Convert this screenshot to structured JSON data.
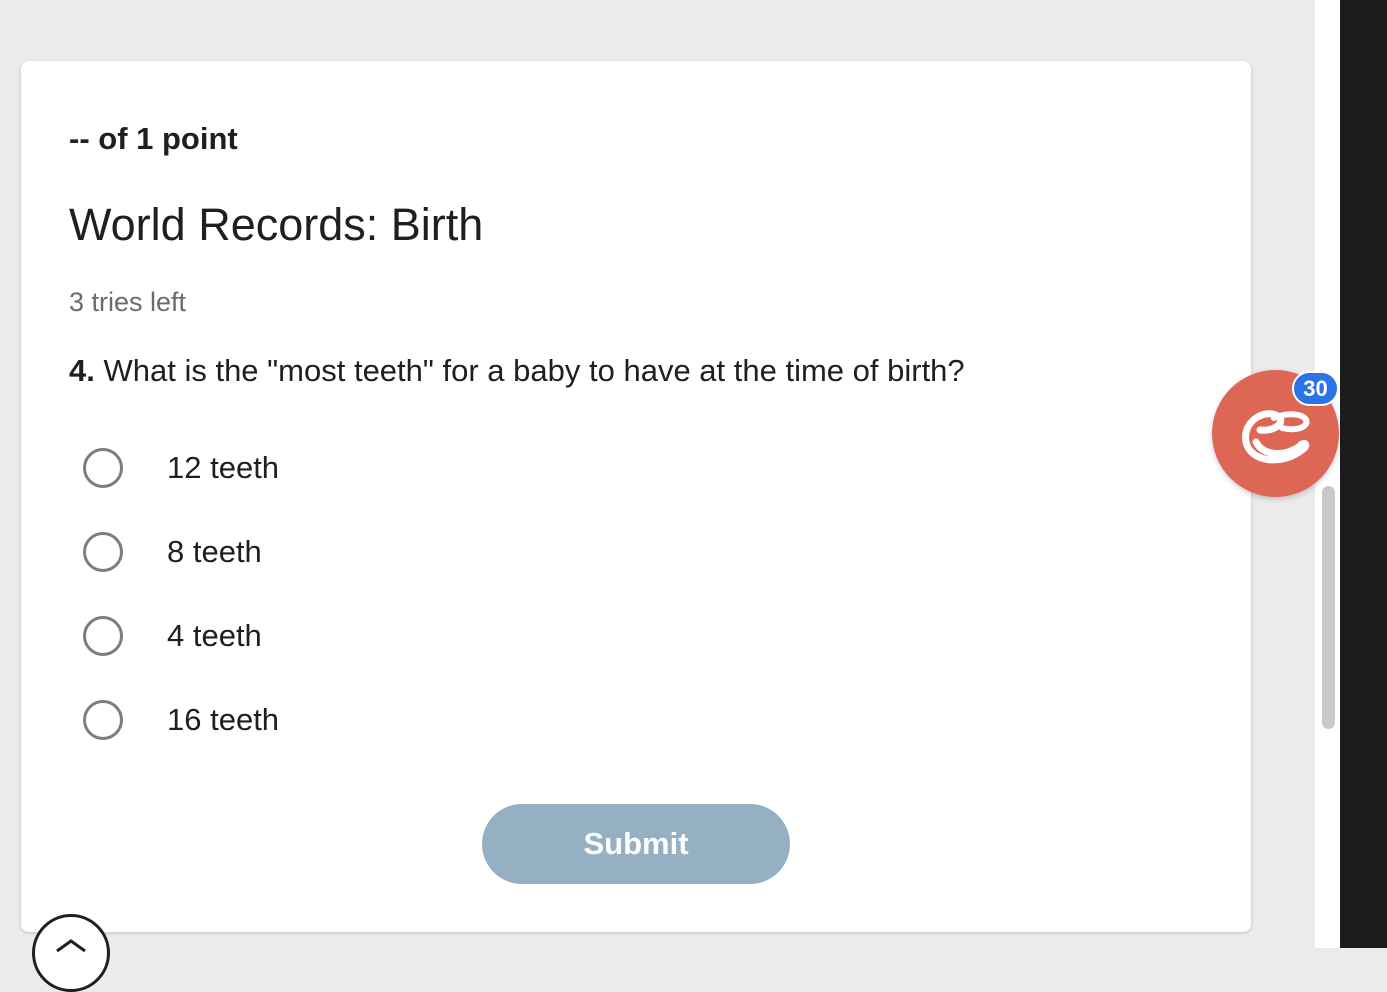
{
  "quiz": {
    "points": "-- of 1 point",
    "title": "World Records: Birth",
    "tries": "3 tries left",
    "question_number": "4.",
    "question_text": "What is the \"most teeth\" for a baby to have at the time of birth?",
    "options": [
      {
        "label": "12 teeth"
      },
      {
        "label": "8 teeth"
      },
      {
        "label": "4 teeth"
      },
      {
        "label": "16 teeth"
      }
    ],
    "submit_label": "Submit"
  },
  "extension": {
    "icon": "cursive-e-logo-icon",
    "badge_count": "30",
    "color": "#dd6655",
    "badge_color": "#2b74e6"
  },
  "colors": {
    "submit_disabled": "#95afc3",
    "page_background": "#ebebeb"
  }
}
